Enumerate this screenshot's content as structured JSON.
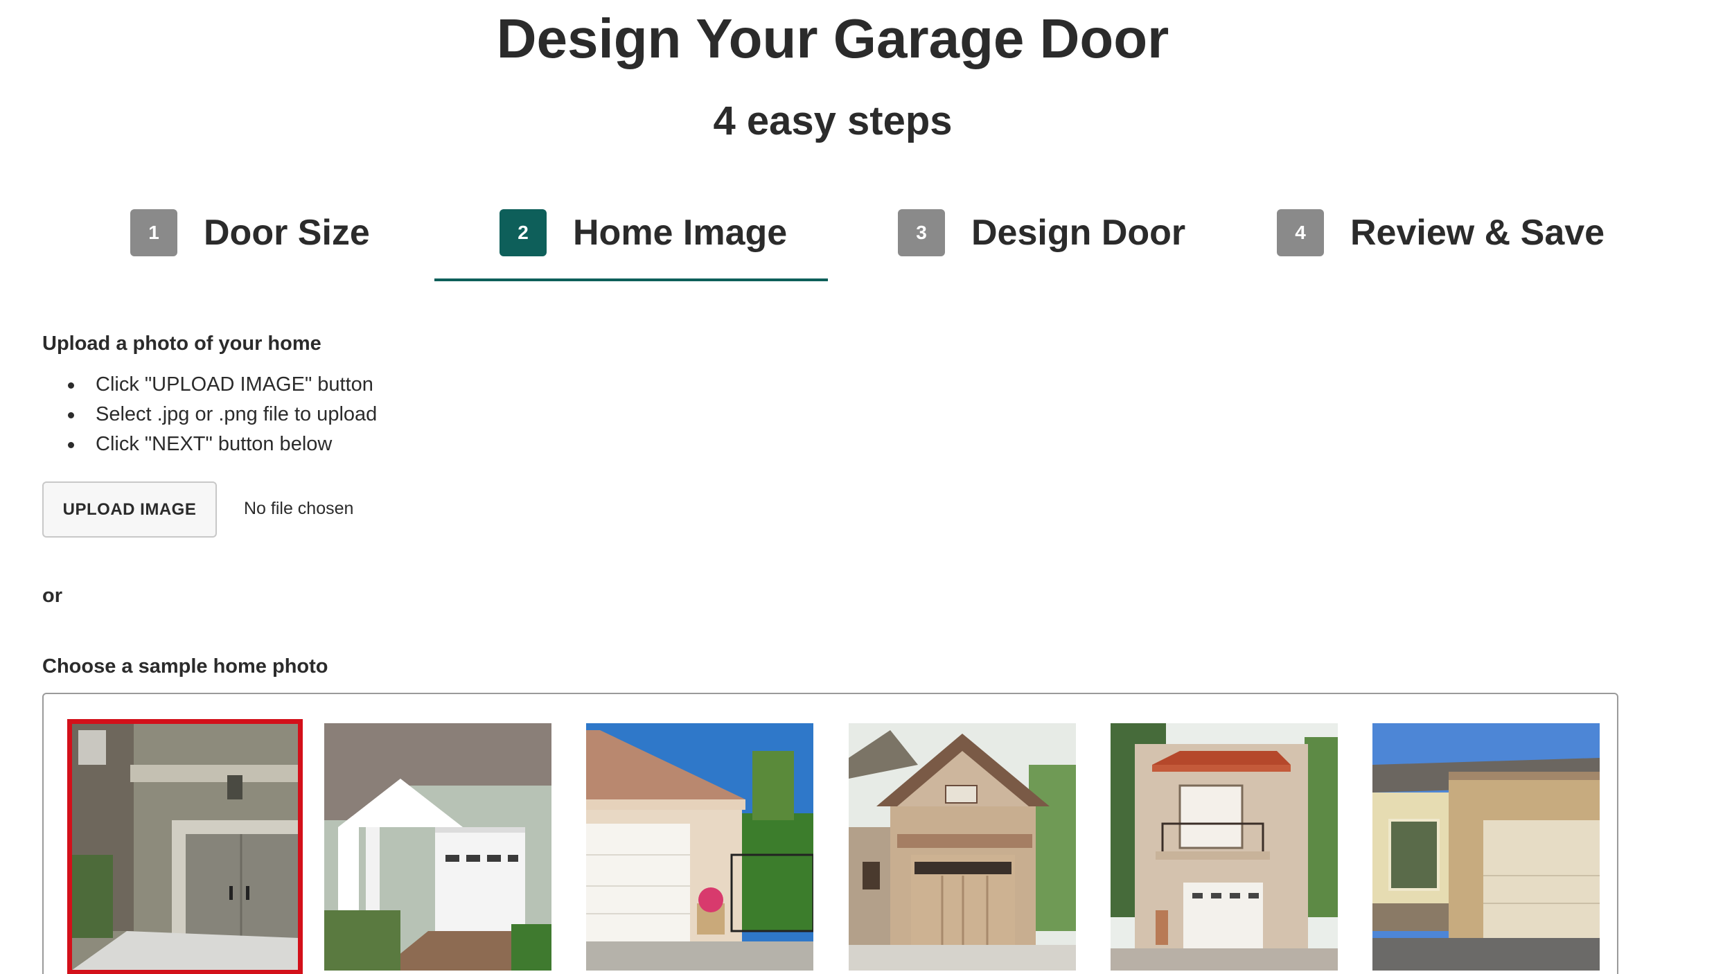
{
  "header": {
    "title": "Design Your Garage Door",
    "subtitle": "4 easy steps"
  },
  "steps": [
    {
      "number": "1",
      "label": "Door Size",
      "active": false
    },
    {
      "number": "2",
      "label": "Home Image",
      "active": true
    },
    {
      "number": "3",
      "label": "Design Door",
      "active": false
    },
    {
      "number": "4",
      "label": "Review & Save",
      "active": false
    }
  ],
  "upload": {
    "heading": "Upload a photo of your home",
    "instructions": [
      "Click \"UPLOAD IMAGE\" button",
      "Select .jpg or .png file to upload",
      "Click \"NEXT\" button below"
    ],
    "button_label": "UPLOAD IMAGE",
    "file_status": "No file chosen"
  },
  "or_text": "or",
  "samples": {
    "heading": "Choose a sample home photo",
    "photos": [
      {
        "name": "stucco-home-carriage-door",
        "selected": true
      },
      {
        "name": "green-siding-home-white-door",
        "selected": false
      },
      {
        "name": "tan-home-white-door-blue-sky",
        "selected": false
      },
      {
        "name": "craftsman-home-tan-door",
        "selected": false
      },
      {
        "name": "spanish-home-balcony-white-door",
        "selected": false
      },
      {
        "name": "brick-stone-home-tan-door",
        "selected": false
      }
    ]
  },
  "colors": {
    "accent": "#0e5f5a",
    "inactive_step": "#8a8a8a",
    "selected_border": "#d3101a"
  }
}
